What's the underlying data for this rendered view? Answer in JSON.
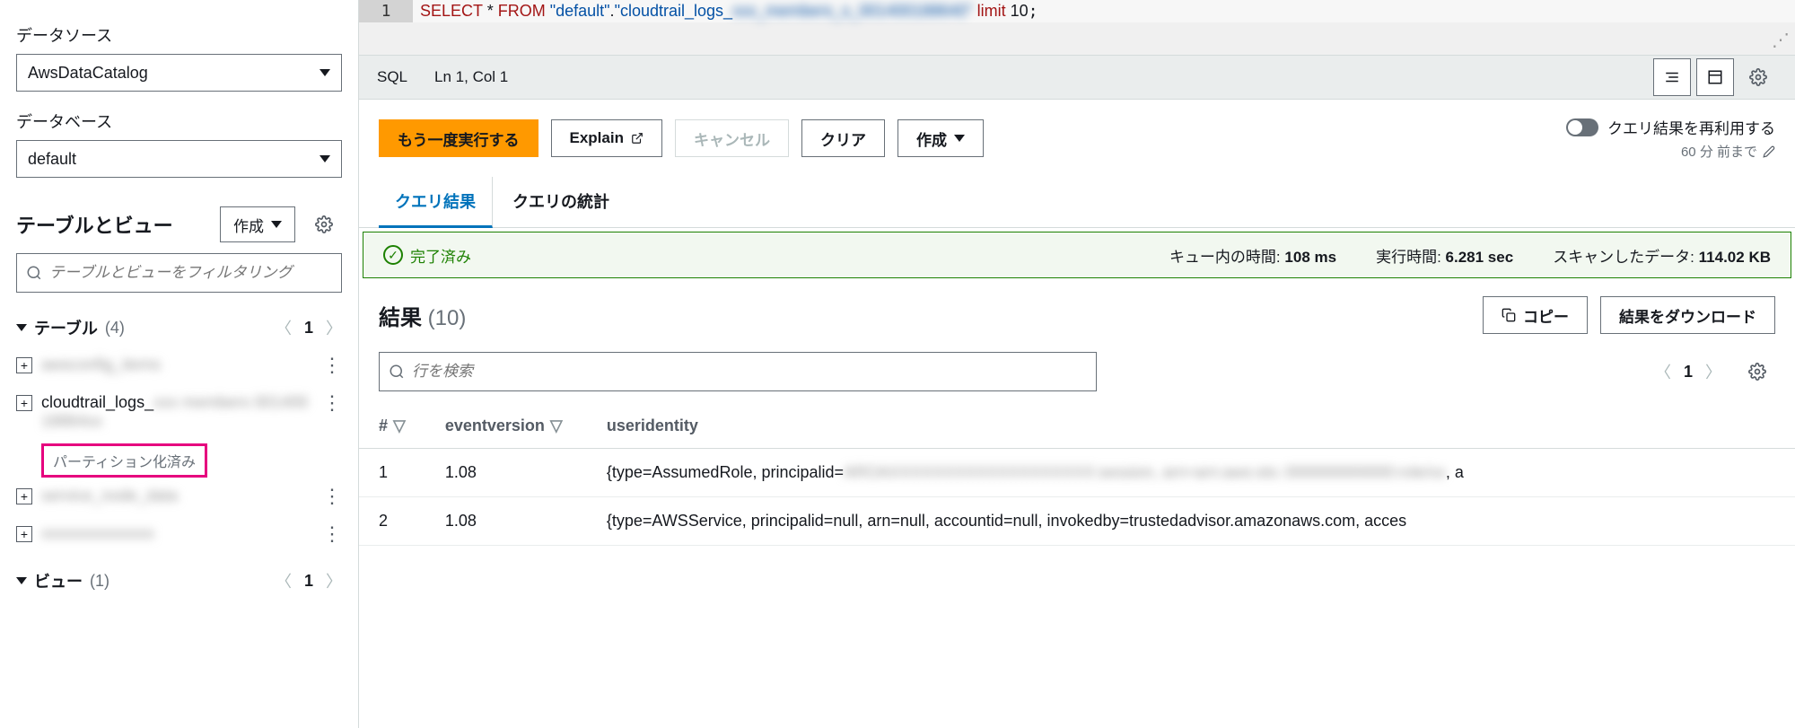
{
  "sidebar": {
    "datasource_label": "データソース",
    "datasource_value": "AwsDataCatalog",
    "database_label": "データベース",
    "database_value": "default",
    "tv_heading": "テーブルとビュー",
    "create_label": "作成",
    "filter_placeholder": "テーブルとビューをフィルタリング",
    "tables_label": "テーブル",
    "tables_count": "(4)",
    "tables_page": "1",
    "views_label": "ビュー",
    "views_count": "(1)",
    "views_page": "1",
    "partitioned_badge": "パーティション化済み",
    "table_items": [
      {
        "name": "awsconfig_items"
      },
      {
        "name": "cloudtrail_logs_xxx_members_00140018864"
      },
      {
        "name": "service_node_data"
      },
      {
        "name": "xxxxxxxxxxxxxx"
      }
    ]
  },
  "editor": {
    "line_no": "1",
    "kw1": "SELECT",
    "star": " * ",
    "kw2": "FROM ",
    "str1": "\"default\"",
    "dot": ".",
    "str2": "\"cloudtrail_logs_",
    "kw3": " limit ",
    "num": "10",
    "status_sql": "SQL",
    "status_pos": "Ln 1, Col 1"
  },
  "toolbar": {
    "run": "もう一度実行する",
    "explain": "Explain",
    "cancel": "キャンセル",
    "clear": "クリア",
    "create": "作成",
    "reuse": "クエリ結果を再利用する",
    "reuse_sub": "60 分 前まで"
  },
  "tabs": {
    "results": "クエリ結果",
    "stats": "クエリの統計"
  },
  "status": {
    "done": "完了済み",
    "queue_label": "キュー内の時間:",
    "queue_val": "108 ms",
    "exec_label": "実行時間:",
    "exec_val": "6.281 sec",
    "scan_label": "スキャンしたデータ:",
    "scan_val": "114.02 KB"
  },
  "results": {
    "heading": "結果",
    "count": "(10)",
    "copy": "コピー",
    "download": "結果をダウンロード",
    "filter_placeholder": "行を検索",
    "page": "1",
    "cols": {
      "idx": "#",
      "ev": "eventversion",
      "ui": "useridentity"
    },
    "rows": [
      {
        "idx": "1",
        "ev": "1.08",
        "ui": "{type=AssumedRole, principalid="
      },
      {
        "idx": "2",
        "ev": "1.08",
        "ui": "{type=AWSService, principalid=null, arn=null, accountid=null, invokedby=trustedadvisor.amazonaws.com, acces"
      }
    ]
  }
}
